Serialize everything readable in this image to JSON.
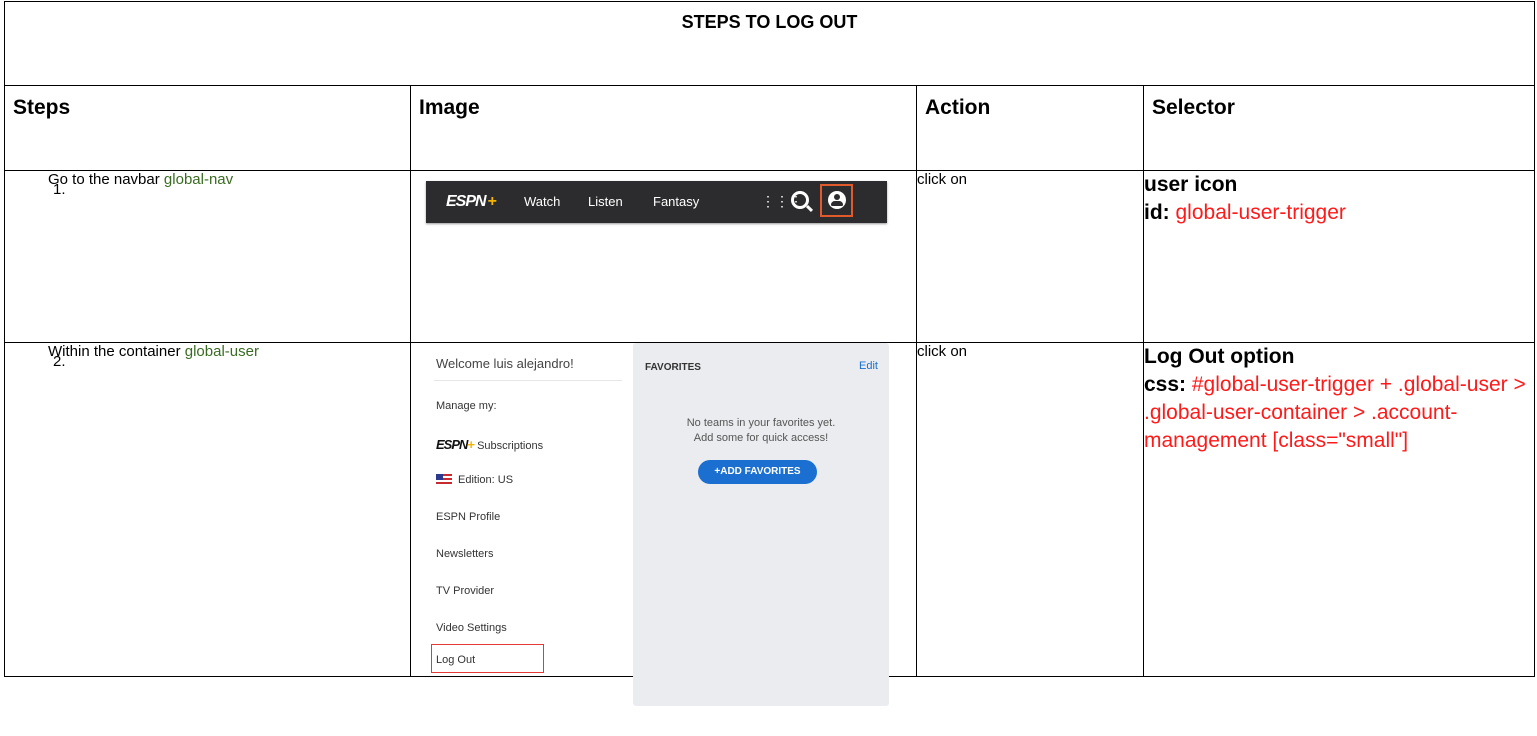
{
  "document": {
    "title": "STEPS TO LOG OUT"
  },
  "headers": {
    "steps": "Steps",
    "image": "Image",
    "action": "Action",
    "selector": "Selector"
  },
  "rows": [
    {
      "num": "1.",
      "text": "Go to the navbar",
      "highlight": "global-nav",
      "action": "click on",
      "selector_title": "user icon",
      "selector_prefix": "id:",
      "selector_value": "global-user-trigger"
    },
    {
      "num": "2.",
      "text": "Within the container",
      "highlight": "global-user",
      "action": "click on",
      "selector_title": "Log Out option",
      "selector_prefix": "css:",
      "selector_value": "#global-user-trigger + .global-user > .global-user-container > .account-management [class=\"small\"]"
    }
  ],
  "nav_image": {
    "logo": "ESPN",
    "logo_plus": "+",
    "items": [
      "Watch",
      "Listen",
      "Fantasy"
    ],
    "icons": [
      "apps-grid-icon",
      "search-icon",
      "user-icon"
    ]
  },
  "dropdown_image": {
    "welcome": "Welcome luis alejandro!",
    "manage": "Manage my:",
    "subscriptions": "Subscriptions",
    "edition": "Edition: US",
    "profile": "ESPN Profile",
    "newsletters": "Newsletters",
    "tv_provider": "TV Provider",
    "video_settings": "Video Settings",
    "log_out": "Log Out",
    "favorites": {
      "heading": "FAVORITES",
      "edit": "Edit",
      "line1": "No teams in your favorites yet.",
      "line2": "Add some for quick access!",
      "button": "+ADD FAVORITES"
    }
  },
  "colors": {
    "highlight_green": "#3a6b23",
    "selector_red": "#ff1a1a",
    "nav_bg": "#2c2c2e",
    "accent_orange": "#e05a2b",
    "espn_blue": "#1a6fd1"
  }
}
